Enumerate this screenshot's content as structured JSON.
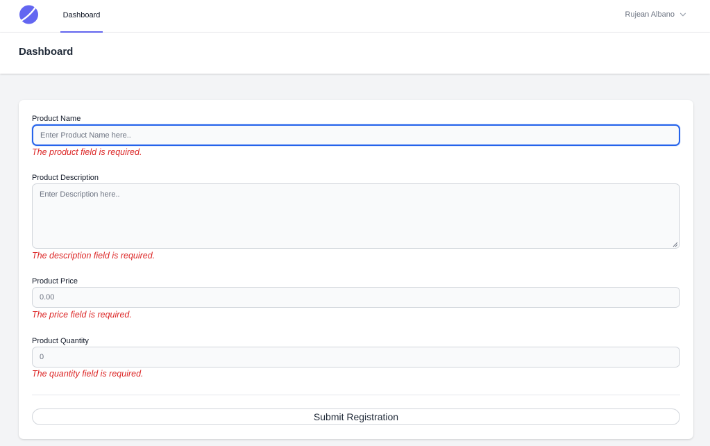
{
  "nav": {
    "logo_color": "#6366f1",
    "dashboard_link": "Dashboard",
    "user_name": "Rujean Albano"
  },
  "header": {
    "title": "Dashboard"
  },
  "form": {
    "name": {
      "label": "Product Name",
      "placeholder": "Enter Product Name here..",
      "value": "",
      "error": "The product field is required."
    },
    "description": {
      "label": "Product Description",
      "placeholder": "Enter Description here..",
      "value": "",
      "error": "The description field is required."
    },
    "price": {
      "label": "Product Price",
      "value": "0.00",
      "error": "The price field is required."
    },
    "quantity": {
      "label": "Product Quantity",
      "value": "0",
      "error": "The quantity field is required."
    },
    "submit_label": "Submit Registration"
  },
  "colors": {
    "accent": "#6366f1",
    "focus_ring": "#2563eb",
    "error": "#dc2626"
  }
}
